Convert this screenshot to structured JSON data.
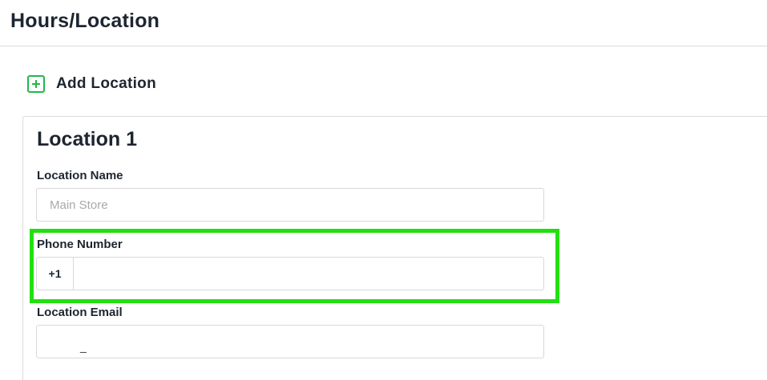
{
  "header": {
    "title": "Hours/Location"
  },
  "add_location": {
    "label": "Add Location",
    "icon": "plus-square-icon",
    "icon_color": "#23b84a"
  },
  "location": {
    "title": "Location 1",
    "name_field": {
      "label": "Location Name",
      "placeholder": "Main Store",
      "value": ""
    },
    "phone_field": {
      "label": "Phone Number",
      "prefix": "+1",
      "value": ""
    },
    "email_field": {
      "label": "Location Email",
      "value": "_"
    }
  },
  "highlight": {
    "color": "#22e010",
    "target": "phone-number-field"
  }
}
